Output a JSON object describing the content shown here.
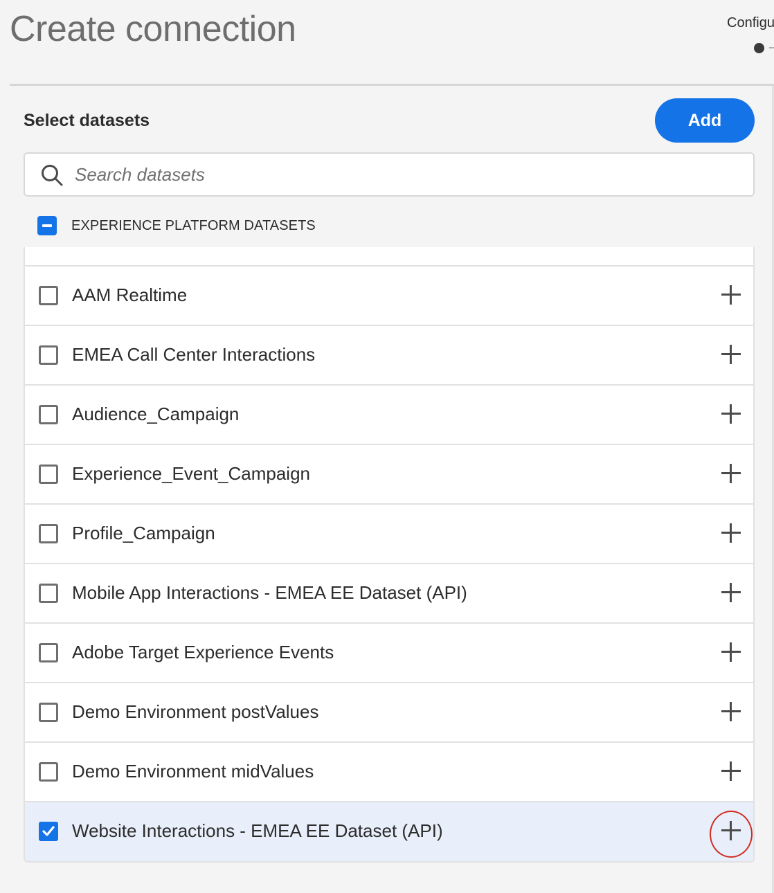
{
  "page": {
    "title": "Create connection"
  },
  "stepper": {
    "current_step_label": "Configure"
  },
  "datasets": {
    "section_title": "Select datasets",
    "add_label": "Add",
    "search_placeholder": "Search datasets",
    "group_label": "EXPERIENCE PLATFORM DATASETS",
    "items": [
      {
        "label": "AAM Realtime",
        "checked": false
      },
      {
        "label": "EMEA Call Center Interactions",
        "checked": false
      },
      {
        "label": "Audience_Campaign",
        "checked": false
      },
      {
        "label": "Experience_Event_Campaign",
        "checked": false
      },
      {
        "label": "Profile_Campaign",
        "checked": false
      },
      {
        "label": "Mobile App Interactions - EMEA EE Dataset (API)",
        "checked": false
      },
      {
        "label": "Adobe Target Experience Events",
        "checked": false
      },
      {
        "label": "Demo Environment postValues",
        "checked": false
      },
      {
        "label": "Demo Environment midValues",
        "checked": false
      },
      {
        "label": "Website Interactions - EMEA EE Dataset (API)",
        "checked": true
      }
    ]
  },
  "colors": {
    "accent": "#1473e6",
    "highlight": "#d22c20",
    "selected_row": "#e8effa"
  }
}
